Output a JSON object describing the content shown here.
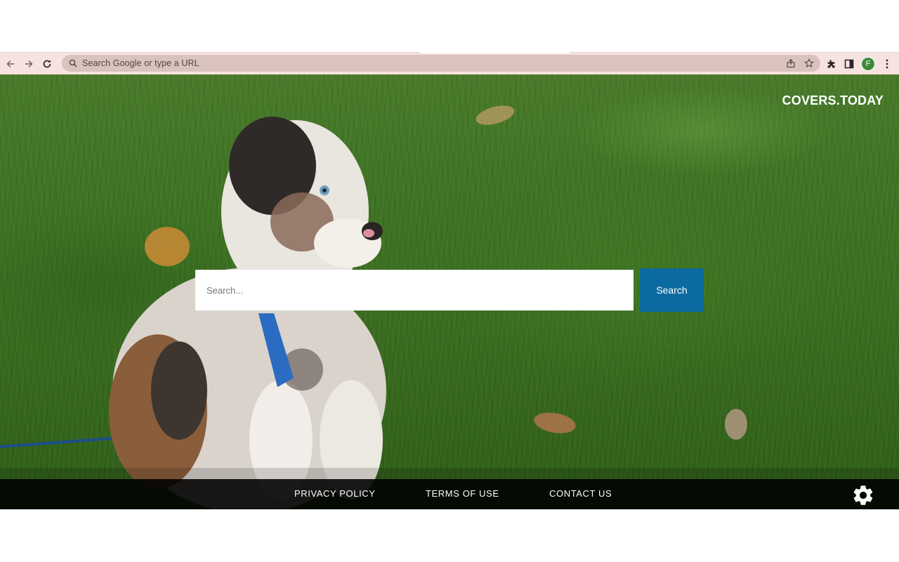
{
  "browser": {
    "omnibox_placeholder": "Search Google or type a URL",
    "avatar_letter": "F",
    "icons": [
      "back-arrow-icon",
      "forward-arrow-icon",
      "reload-icon",
      "search-icon",
      "share-icon",
      "star-icon",
      "extensions-icon",
      "side-panel-icon",
      "more-vert-icon"
    ]
  },
  "page": {
    "brand": "COVERS.TODAY",
    "search": {
      "placeholder": "Search...",
      "button_label": "Search"
    },
    "footer": {
      "links": [
        "PRIVACY POLICY",
        "TERMS OF USE",
        "CONTACT US"
      ],
      "settings_icon": "gear-icon"
    },
    "colors": {
      "search_button": "#0b6aa0",
      "toolbar": "#f6e3df",
      "footer": "#000000"
    }
  }
}
